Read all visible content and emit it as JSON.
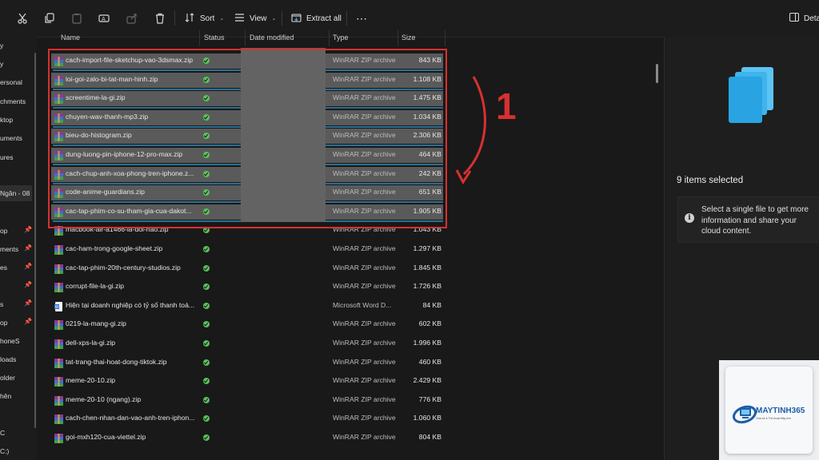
{
  "toolbar": {
    "sort_label": "Sort",
    "view_label": "View",
    "extract_label": "Extract all",
    "details_label": "Details"
  },
  "nav": {
    "items": [
      {
        "label": "y"
      },
      {
        "label": "ersonal"
      },
      {
        "label": "chments"
      },
      {
        "label": "ktop"
      },
      {
        "label": "uments"
      },
      {
        "label": "ures"
      },
      {
        "label": "Ngân - 08"
      },
      {
        "label": "op"
      },
      {
        "label": "ments"
      },
      {
        "label": "es"
      },
      {
        "label": "s"
      },
      {
        "label": "op"
      },
      {
        "label": "honeS"
      },
      {
        "label": "loads"
      },
      {
        "label": "older"
      },
      {
        "label": "hên"
      },
      {
        "label": "C"
      },
      {
        "label": "C:)"
      }
    ]
  },
  "columns": {
    "name": "Name",
    "status": "Status",
    "date_modified": "Date modified",
    "type": "Type",
    "size": "Size"
  },
  "files": [
    {
      "name": "cach-import-file-sketchup-vao-3dsmax.zip",
      "type": "WinRAR ZIP archive",
      "size": "843 KB",
      "selected": true
    },
    {
      "name": "loi-goi-zalo-bi-tat-man-hinh.zip",
      "type": "WinRAR ZIP archive",
      "size": "1.108 KB",
      "selected": true
    },
    {
      "name": "screentime-la-gi.zip",
      "type": "WinRAR ZIP archive",
      "size": "1.475 KB",
      "selected": true
    },
    {
      "name": "chuyen-wav-thanh-mp3.zip",
      "type": "WinRAR ZIP archive",
      "size": "1.034 KB",
      "selected": true
    },
    {
      "name": "bieu-do-histogram.zip",
      "type": "WinRAR ZIP archive",
      "size": "2.306 KB",
      "selected": true
    },
    {
      "name": "dung-luong-pin-iphone-12-pro-max.zip",
      "type": "WinRAR ZIP archive",
      "size": "464 KB",
      "selected": true
    },
    {
      "name": "cach-chup-anh-xoa-phong-tren-iphone.z...",
      "type": "WinRAR ZIP archive",
      "size": "242 KB",
      "selected": true
    },
    {
      "name": "code-anime-guardians.zip",
      "type": "WinRAR ZIP archive",
      "size": "651 KB",
      "selected": true
    },
    {
      "name": "cac-tap-phim-co-su-tham-gia-cua-dakot...",
      "type": "WinRAR ZIP archive",
      "size": "1.905 KB",
      "selected": true
    },
    {
      "name": "macbook-air-a1466-la-doi-nao.zip",
      "type": "WinRAR ZIP archive",
      "size": "1.043 KB",
      "selected": false
    },
    {
      "name": "cac-ham-trong-google-sheet.zip",
      "type": "WinRAR ZIP archive",
      "size": "1.297 KB",
      "selected": false
    },
    {
      "name": "cac-tap-phim-20th-century-studios.zip",
      "type": "WinRAR ZIP archive",
      "size": "1.845 KB",
      "selected": false
    },
    {
      "name": "corrupt-file-la-gi.zip",
      "type": "WinRAR ZIP archive",
      "size": "1.726 KB",
      "selected": false
    },
    {
      "name": "Hiện tại doanh nghiệp có tỷ số thanh toá...",
      "type": "Microsoft Word D...",
      "size": "84 KB",
      "selected": false,
      "word": true
    },
    {
      "name": "0219-la-mang-gi.zip",
      "type": "WinRAR ZIP archive",
      "size": "602 KB",
      "selected": false
    },
    {
      "name": "dell-xps-la-gi.zip",
      "type": "WinRAR ZIP archive",
      "size": "1.996 KB",
      "selected": false
    },
    {
      "name": "tat-trang-thai-hoat-dong-tiktok.zip",
      "type": "WinRAR ZIP archive",
      "size": "460 KB",
      "selected": false
    },
    {
      "name": "meme-20-10.zip",
      "type": "WinRAR ZIP archive",
      "size": "2.429 KB",
      "selected": false
    },
    {
      "name": "meme-20-10 (ngang).zip",
      "type": "WinRAR ZIP archive",
      "size": "776 KB",
      "selected": false
    },
    {
      "name": "cach-chen-nhan-dan-vao-anh-tren-iphon...",
      "type": "WinRAR ZIP archive",
      "size": "1.060 KB",
      "selected": false
    },
    {
      "name": "goi-mxh120-cua-viettel.zip",
      "type": "WinRAR ZIP archive",
      "size": "804 KB",
      "selected": false
    }
  ],
  "annotation": {
    "number": "1",
    "color": "#d8302f"
  },
  "details": {
    "selected_count": "9 items selected",
    "info_text": "Select a single file to get more information and share your cloud content."
  },
  "watermark": {
    "brand": "MAYTINH365",
    "tagline": "Chia sẻ & Thủ thuật Máy tính"
  },
  "colors": {
    "accent": "#2a6f93",
    "highlight": "#d8302f",
    "status_ok": "#58c25b"
  }
}
